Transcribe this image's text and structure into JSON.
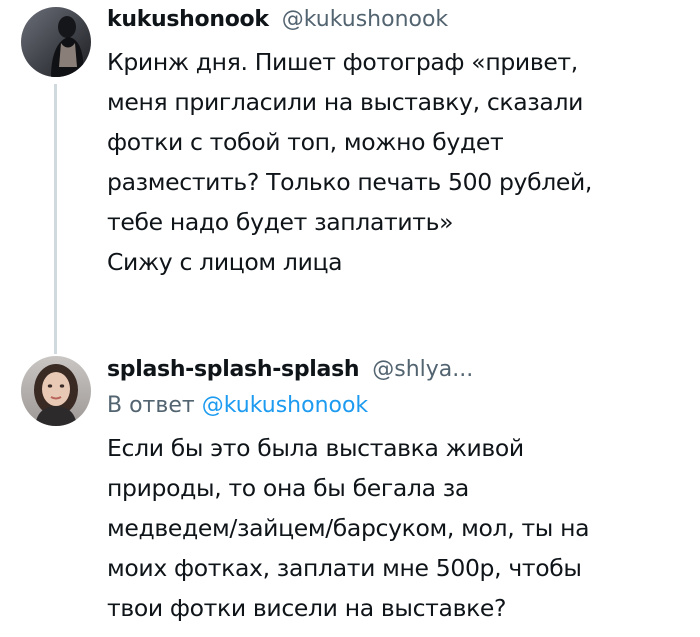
{
  "tweets": [
    {
      "display_name": "kukushonook",
      "handle": "@kukushonook",
      "avatar_icon": "user-avatar-photo",
      "lines": [
        "Кринж дня. Пишет фотограф «привет,",
        "меня пригласили на выставку, сказали",
        "фотки с тобой топ, можно будет",
        "разместить? Только печать 500 рублей,",
        "тебе надо будет заплатить»",
        "Сижу с лицом лица"
      ]
    },
    {
      "display_name": "splash-splash-splash",
      "handle": "@shlya...",
      "avatar_icon": "user-avatar-photo",
      "reply_prefix": "В ответ",
      "reply_to": "@kukushonook",
      "lines": [
        "Если бы это была выставка живой",
        "природы, то она бы бегала за",
        "медведем/зайцем/барсуком, мол, ты на",
        "моих фотках, заплати мне 500р, чтобы",
        "твои фотки висели на выставке?"
      ]
    }
  ],
  "colors": {
    "text": "#0f1419",
    "secondary": "#536471",
    "link": "#1d9bf0",
    "thread_line": "#cfd9de"
  }
}
